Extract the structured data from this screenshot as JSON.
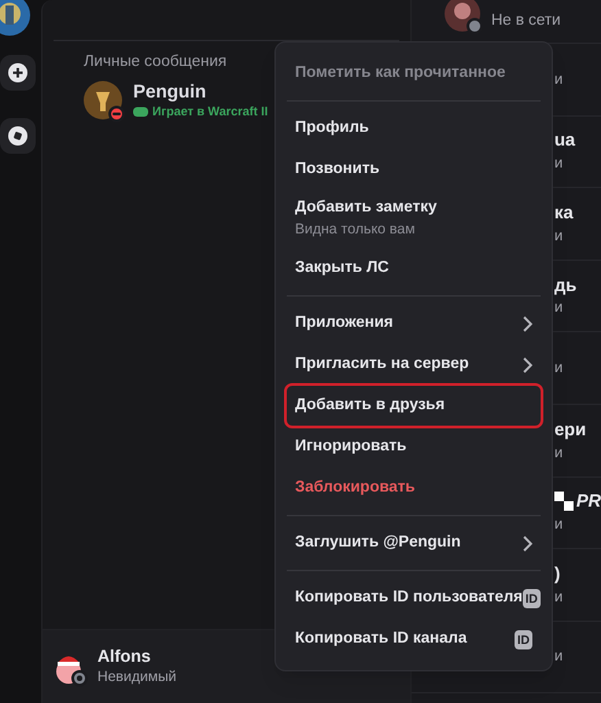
{
  "direct_messages": {
    "heading": "Личные сообщения",
    "items": [
      {
        "name": "Penguin",
        "activity": "Играет в Warcraft II",
        "color": "#f23f43"
      }
    ]
  },
  "user_panel": {
    "name": "Alfons",
    "status_text": "Невидимый",
    "color": "#80848e"
  },
  "member_list": {
    "top": {
      "status_text": "Не в сети"
    },
    "rows": [
      {
        "status_fragment": "и"
      },
      {
        "name_fragment": "ua",
        "status_fragment": "и"
      },
      {
        "name_fragment": "ка",
        "status_fragment": "и"
      },
      {
        "name_fragment": "дь",
        "status_fragment": "и"
      },
      {
        "status_fragment": "и"
      },
      {
        "name_fragment": "ери",
        "status_fragment": "и"
      },
      {
        "name_fragment": "PR",
        "status_fragment": "и",
        "kind": "badge"
      },
      {
        "name_fragment": ")",
        "status_fragment": "и"
      },
      {
        "status_fragment": "и"
      }
    ]
  },
  "context_menu": {
    "groups": [
      [
        {
          "kind": "muted",
          "label": "Пометить как прочитанное"
        }
      ],
      [
        {
          "kind": "item",
          "label": "Профиль"
        },
        {
          "kind": "item",
          "label": "Позвонить"
        },
        {
          "kind": "item",
          "label": "Добавить заметку",
          "hint": "Видна только вам"
        },
        {
          "kind": "item",
          "label": "Закрыть ЛС"
        }
      ],
      [
        {
          "kind": "submenu",
          "label": "Приложения"
        },
        {
          "kind": "submenu",
          "label": "Пригласить на сервер"
        },
        {
          "kind": "item",
          "label": "Добавить в друзья",
          "outlined": true
        },
        {
          "kind": "item",
          "label": "Игнорировать"
        },
        {
          "kind": "danger",
          "label": "Заблокировать"
        }
      ],
      [
        {
          "kind": "submenu",
          "label": "Заглушить @Penguin"
        }
      ],
      [
        {
          "kind": "id",
          "label": "Копировать ID пользователя",
          "badge": "ID"
        },
        {
          "kind": "id",
          "label": "Копировать ID канала",
          "badge": "ID"
        }
      ]
    ]
  }
}
